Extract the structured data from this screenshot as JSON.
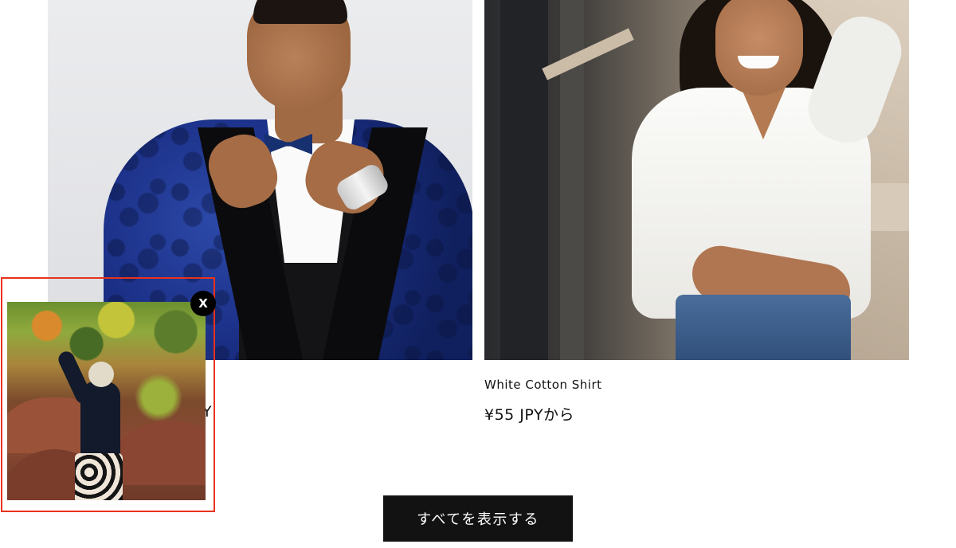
{
  "products": [
    {
      "image_icon": "product-photo-man-blue-tuxedo",
      "title": "",
      "price": "",
      "price_tail": "Y"
    },
    {
      "image_icon": "product-photo-woman-white-shirt",
      "title": "White Cotton Shirt",
      "price": "¥55 JPYから"
    }
  ],
  "view_all_button": {
    "label": "すべてを表示する"
  },
  "video_popup": {
    "media_icon": "video-thumbnail-woman-canyon",
    "close_label": "X",
    "frame_color": "#e8321c"
  },
  "colors": {
    "button_bg": "#121212",
    "button_text": "#ffffff",
    "text": "#121212"
  }
}
